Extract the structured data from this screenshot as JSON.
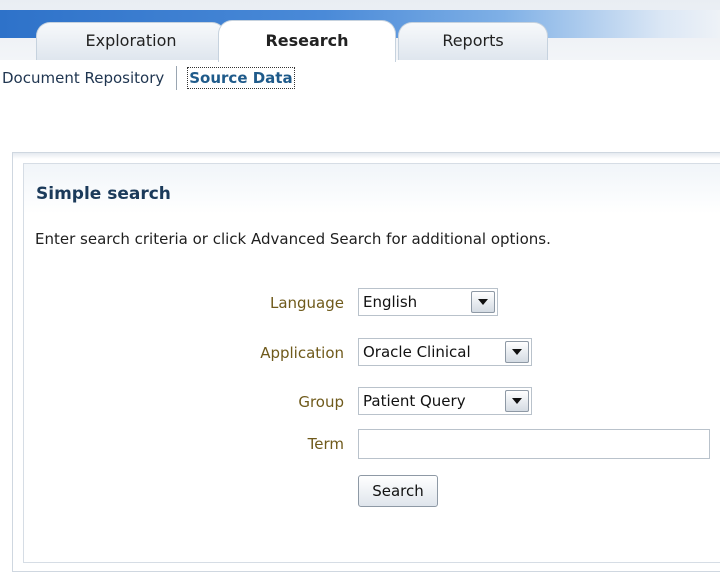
{
  "tabs": [
    {
      "label": "Exploration",
      "active": false
    },
    {
      "label": "Research",
      "active": true
    },
    {
      "label": "Reports",
      "active": false
    }
  ],
  "subnav": {
    "items": [
      {
        "label": "Document Repository",
        "active": false
      },
      {
        "label": "Source Data",
        "active": true
      }
    ]
  },
  "panel": {
    "title": "Simple search",
    "description": "Enter search criteria or click Advanced Search for additional options."
  },
  "form": {
    "language": {
      "label": "Language",
      "value": "English"
    },
    "application": {
      "label": "Application",
      "value": "Oracle Clinical"
    },
    "group": {
      "label": "Group",
      "value": "Patient Query"
    },
    "term": {
      "label": "Term",
      "value": "",
      "placeholder": ""
    },
    "search_button": "Search"
  },
  "colors": {
    "tab_strip_blue": "#2e72c9",
    "label_text": "#6f5a1b",
    "title_text": "#1b3a5a",
    "active_link": "#1e5a8a"
  }
}
